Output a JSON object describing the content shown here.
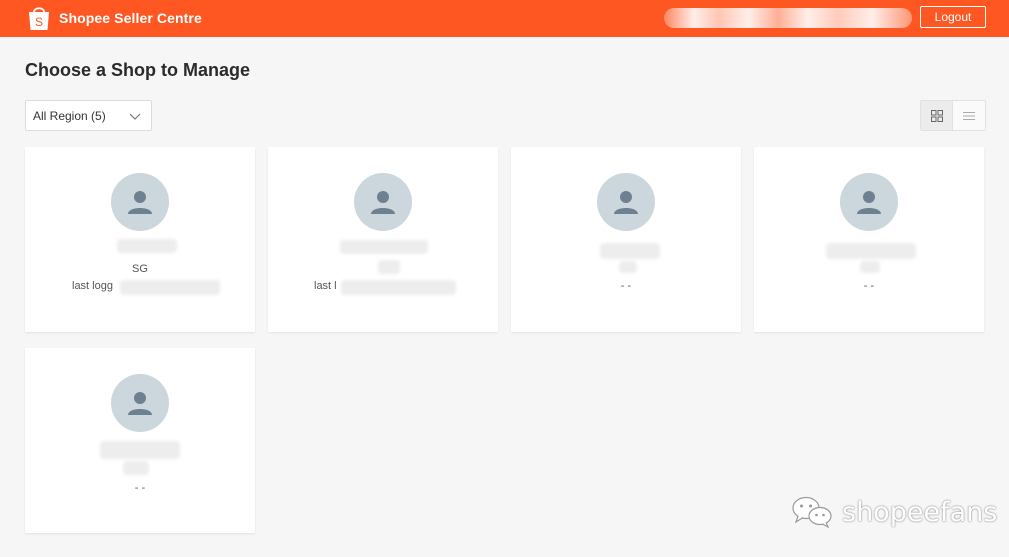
{
  "header": {
    "brand_name": "Shopee Seller Centre",
    "logo_letter": "S",
    "logout_label": "Logout"
  },
  "page": {
    "title": "Choose a Shop to Manage",
    "region_filter": "All Region (5)"
  },
  "shops": [
    {
      "region": "SG",
      "last_login_label": "last logg",
      "status": ""
    },
    {
      "region": "",
      "last_login_label": "last l",
      "status": ""
    },
    {
      "region": "",
      "last_login_label": "",
      "status": "- -"
    },
    {
      "region": "",
      "last_login_label": "",
      "status": "- -"
    },
    {
      "region": "",
      "last_login_label": "",
      "status": "- -"
    }
  ],
  "watermark": {
    "text": "shopeefans",
    "icon": "wechat-icon"
  },
  "colors": {
    "brand": "#fe5722",
    "avatar_bg": "#ccd6dd",
    "avatar_fg": "#6e8190"
  }
}
